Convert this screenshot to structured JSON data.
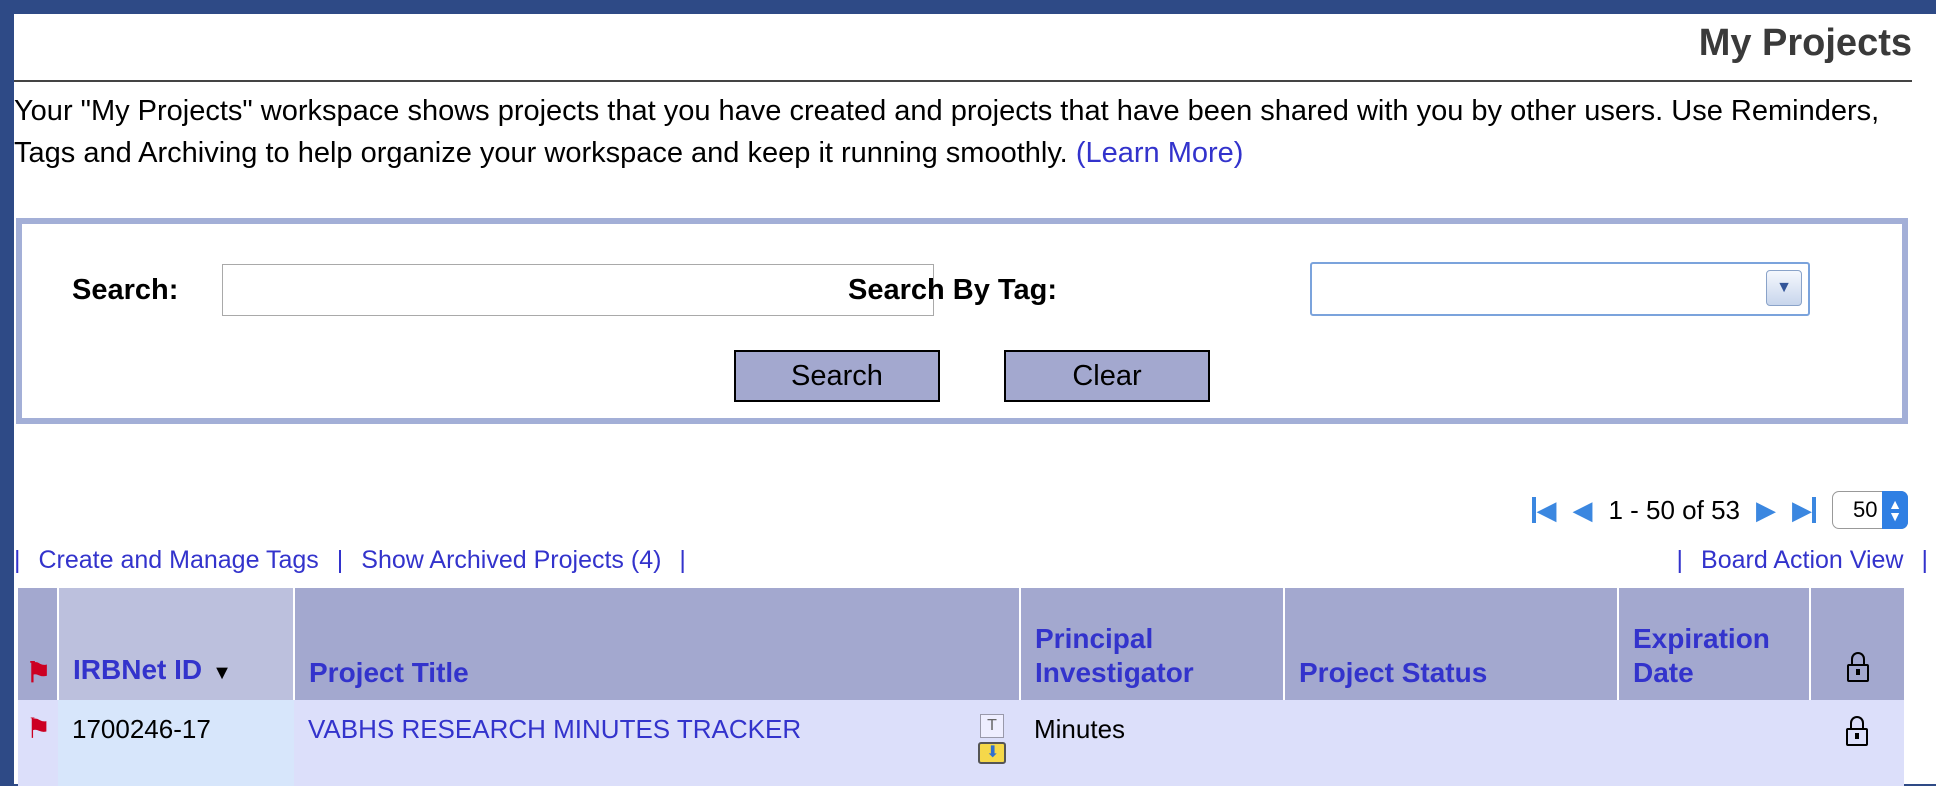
{
  "page": {
    "title": "My Projects",
    "intro_text": "Your \"My Projects\" workspace shows projects that you have created and projects that have been shared with you by other users. Use Reminders, Tags and Archiving to help organize your workspace and keep it running smoothly.",
    "learn_more": "(Learn More)"
  },
  "search": {
    "search_label": "Search:",
    "search_value": "",
    "tag_label": "Search By Tag:",
    "tag_value": "",
    "search_button": "Search",
    "clear_button": "Clear"
  },
  "pager": {
    "range_text": "1 - 50 of 53",
    "per_page": "50"
  },
  "links": {
    "create_tags": "Create and Manage Tags",
    "archived": "Show Archived Projects (4)",
    "board_action": "Board Action View",
    "separator": "|"
  },
  "table": {
    "headers": {
      "irbnet_id": "IRBNet ID",
      "project_title": "Project Title",
      "pi": "Principal Investigator",
      "status": "Project Status",
      "expiration": "Expiration Date"
    },
    "rows": [
      {
        "id": "1700246-17",
        "title": "VABHS RESEARCH MINUTES TRACKER",
        "pi": "Minutes",
        "status": "",
        "expiration": ""
      }
    ]
  },
  "icons": {
    "flag": "red-flag",
    "lock": "padlock",
    "tag": "T"
  },
  "colors": {
    "frame_border": "#2e4a86",
    "header_bg": "#a3a8cf",
    "link": "#3333cc",
    "row_bg": "#dcdffa",
    "flag": "#cc0022"
  }
}
